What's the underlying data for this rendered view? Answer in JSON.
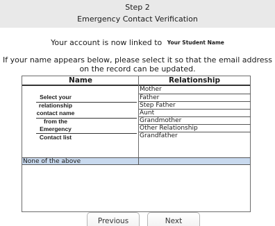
{
  "header": {
    "step": "Step 2",
    "subtitle": "Emergency Contact Verification"
  },
  "linked": {
    "text": "Your account is now linked to",
    "student_name": "Your Student Name"
  },
  "instructions": {
    "line1": "If your name appears below, please select it so that the email address",
    "line2": "on the record can be updated."
  },
  "table": {
    "headers": {
      "name": "Name",
      "relationship": "Relationship"
    },
    "left_label_lines": [
      "Select your",
      "relationship",
      "contact name",
      "from the",
      "Emergency",
      "Contact list"
    ],
    "relationships": [
      "Mother",
      "Father",
      "Step Father",
      "Aunt",
      "Grandmother",
      "Other Relationship",
      "Grandfather"
    ],
    "none_option": "None of the above",
    "none_highlight_color": "#c8d9ee"
  },
  "buttons": {
    "previous": "Previous",
    "next": "Next"
  }
}
